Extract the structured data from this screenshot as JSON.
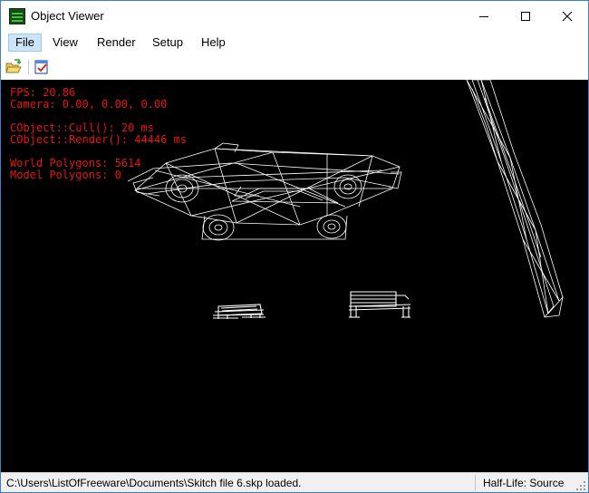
{
  "window": {
    "title": "Object Viewer"
  },
  "menu": [
    "File",
    "View",
    "Render",
    "Setup",
    "Help"
  ],
  "toolbar": [
    {
      "name": "open-folder-icon"
    },
    {
      "name": "check-document-icon"
    }
  ],
  "viewport": {
    "fps": "FPS: 20.86",
    "camera": "Camera: 0.00, 0.00, 0.00",
    "cull": "CObject::Cull(): 20 ms",
    "render": "CObject::Render(): 44446 ms",
    "world_polygons": "World Polygons: 5614",
    "model_polygons": "Model Polygons: 0",
    "scene_objects": [
      "car-wireframe",
      "bench-small",
      "bench-large",
      "lamp-post"
    ]
  },
  "status": {
    "message": "C:\\Users\\ListOfFreeware\\Documents\\Skitch file 6.skp loaded.",
    "mode": "Half-Life: Source"
  },
  "colors": {
    "overlay_text": "#e41414",
    "wireframe": "#ffffff",
    "viewport_bg": "#000000"
  }
}
